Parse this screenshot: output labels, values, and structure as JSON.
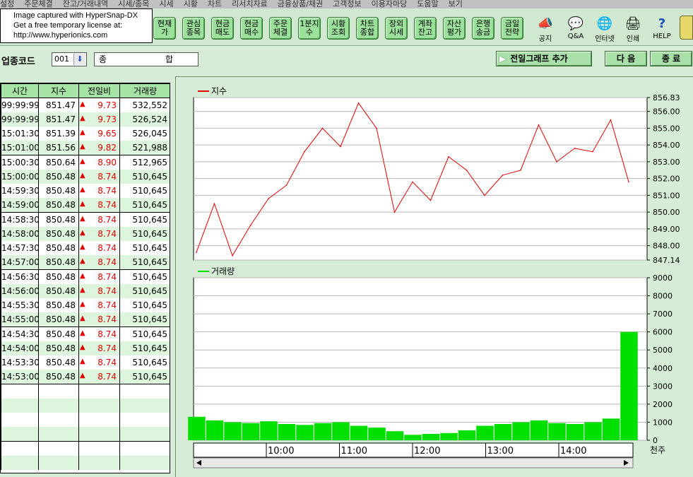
{
  "menu": [
    "설정",
    "주문체결",
    "잔고/거래내역",
    "시세/종목",
    "시세",
    "시황",
    "차트",
    "리서치자료",
    "금융상품/채권",
    "고객정보",
    "이용자마당",
    "도움말",
    "보기"
  ],
  "popup": {
    "line1": "Image captured with HyperSnap-DX",
    "line2": "Get a free temporary license at:",
    "line3": "http://www.hyperionics.com"
  },
  "toolbar_buttons": [
    "현재가",
    "관심종목",
    "현금매도",
    "현금매수",
    "주문체결",
    "1분지수",
    "시황조회",
    "차트종합",
    "장외시세",
    "계좌잔고",
    "자산평가",
    "은행송금",
    "금일전략"
  ],
  "toolbar_icons": [
    {
      "label": "공지",
      "icon": "notice-icon"
    },
    {
      "label": "Q&A",
      "icon": "qa-icon"
    },
    {
      "label": "인터넷",
      "icon": "globe-icon"
    },
    {
      "label": "인쇄",
      "icon": "printer-icon"
    },
    {
      "label": "HELP",
      "icon": "help-icon"
    }
  ],
  "header": {
    "code_label": "업종코드",
    "code_value": "001",
    "name_left": "종",
    "name_right": "합",
    "add_graph": "전일그래프 추가",
    "next": "다 음",
    "close": "종 료"
  },
  "table": {
    "columns": [
      "시간",
      "지수",
      "전일비",
      "거래량"
    ],
    "rows": [
      [
        "99:99:99",
        "851.47",
        "9.73",
        "532,552"
      ],
      [
        "99:99:99",
        "851.47",
        "9.73",
        "526,524"
      ],
      [
        "15:01:30",
        "851.39",
        "9.65",
        "526,045"
      ],
      [
        "15:01:00",
        "851.56",
        "9.82",
        "521,988"
      ],
      [
        "15:00:30",
        "850.64",
        "8.90",
        "512,965"
      ],
      [
        "15:00:00",
        "850.48",
        "8.74",
        "510,645"
      ],
      [
        "14:59:30",
        "850.48",
        "8.74",
        "510,645"
      ],
      [
        "14:59:00",
        "850.48",
        "8.74",
        "510,645"
      ],
      [
        "14:58:30",
        "850.48",
        "8.74",
        "510,645"
      ],
      [
        "14:58:00",
        "850.48",
        "8.74",
        "510,645"
      ],
      [
        "14:57:30",
        "850.48",
        "8.74",
        "510,645"
      ],
      [
        "14:57:00",
        "850.48",
        "8.74",
        "510,645"
      ],
      [
        "14:56:30",
        "850.48",
        "8.74",
        "510,645"
      ],
      [
        "14:56:00",
        "850.48",
        "8.74",
        "510,645"
      ],
      [
        "14:55:30",
        "850.48",
        "8.74",
        "510,645"
      ],
      [
        "14:55:00",
        "850.48",
        "8.74",
        "510,645"
      ],
      [
        "14:54:30",
        "850.48",
        "8.74",
        "510,645"
      ],
      [
        "14:54:00",
        "850.48",
        "8.74",
        "510,645"
      ],
      [
        "14:53:30",
        "850.48",
        "8.74",
        "510,645"
      ],
      [
        "14:53:00",
        "850.48",
        "8.74",
        "510,645"
      ]
    ],
    "empty_rows": 6
  },
  "chart_data": [
    {
      "type": "line",
      "legend": "지수",
      "color": "#e00000",
      "ylim": [
        847.14,
        856.83
      ],
      "yticks": [
        "856.83",
        "856.00",
        "855.00",
        "854.00",
        "853.00",
        "852.00",
        "851.00",
        "850.00",
        "849.00",
        "848.00",
        "847.14"
      ],
      "x": [
        "09:00",
        "09:15",
        "09:30",
        "09:45",
        "10:00",
        "10:15",
        "10:30",
        "10:45",
        "11:00",
        "11:15",
        "11:30",
        "11:45",
        "12:00",
        "12:15",
        "12:30",
        "12:45",
        "13:00",
        "13:15",
        "13:30",
        "13:45",
        "14:00",
        "14:15",
        "14:30",
        "14:45",
        "15:00"
      ],
      "values": [
        847.6,
        850.5,
        847.4,
        849.2,
        850.8,
        851.6,
        853.6,
        855.0,
        853.9,
        856.5,
        855.0,
        850.0,
        851.8,
        850.7,
        853.3,
        852.5,
        851.0,
        852.2,
        852.5,
        855.2,
        853.0,
        853.8,
        853.6,
        855.5,
        851.8
      ]
    },
    {
      "type": "area",
      "legend": "거래량",
      "color": "#00e000",
      "unit": "천주",
      "ylim": [
        0,
        9000
      ],
      "yticks": [
        "9000",
        "8000",
        "7000",
        "6000",
        "5000",
        "4000",
        "3000",
        "2000",
        "1000",
        "0"
      ],
      "xticks": [
        "10:00",
        "11:00",
        "12:00",
        "13:00",
        "14:00"
      ],
      "x": [
        "09:00",
        "09:15",
        "09:30",
        "09:45",
        "10:00",
        "10:15",
        "10:30",
        "10:45",
        "11:00",
        "11:15",
        "11:30",
        "11:45",
        "12:00",
        "12:15",
        "12:30",
        "12:45",
        "13:00",
        "13:15",
        "13:30",
        "13:45",
        "14:00",
        "14:15",
        "14:30",
        "14:45",
        "15:00"
      ],
      "values": [
        1300,
        1100,
        1000,
        950,
        1050,
        900,
        850,
        950,
        1000,
        800,
        700,
        500,
        300,
        350,
        400,
        550,
        800,
        900,
        1000,
        1100,
        950,
        900,
        1000,
        1200,
        6000
      ]
    }
  ]
}
